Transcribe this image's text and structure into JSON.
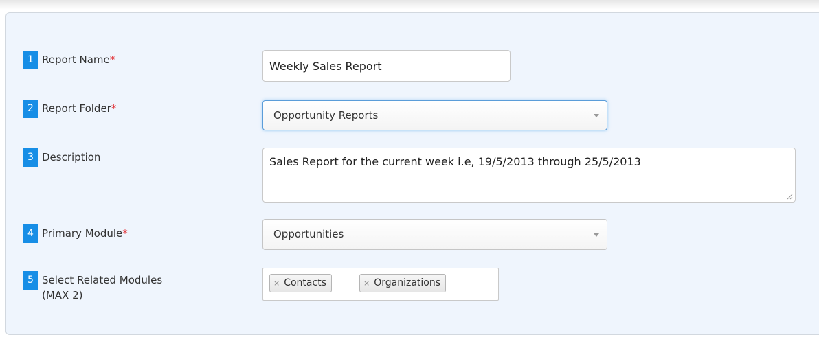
{
  "rows": [
    {
      "number": "1",
      "label": "Report Name",
      "required_mark": "*"
    },
    {
      "number": "2",
      "label": "Report Folder",
      "required_mark": "*"
    },
    {
      "number": "3",
      "label": "Description",
      "required_mark": ""
    },
    {
      "number": "4",
      "label": "Primary Module",
      "required_mark": "*"
    },
    {
      "number": "5",
      "label": "Select Related Modules",
      "label_line2": "(MAX 2)",
      "required_mark": ""
    }
  ],
  "fields": {
    "report_name_value": "Weekly Sales Report",
    "report_folder_value": "Opportunity Reports",
    "description_value": "Sales Report for the current week i.e, 19/5/2013 through 25/5/2013",
    "primary_module_value": "Opportunities",
    "related_modules": [
      "Contacts",
      "Organizations"
    ],
    "chip_remove_glyph": "×"
  },
  "icons": {
    "dropdown": "caret-down-icon",
    "resize": "resize-grip-icon",
    "remove": "remove-x-icon"
  },
  "colors": {
    "panel_background": "#eff5fd",
    "number_badge": "#178ee6",
    "required_asterisk": "#e2353a",
    "focus_ring": "#5b9dd9"
  }
}
